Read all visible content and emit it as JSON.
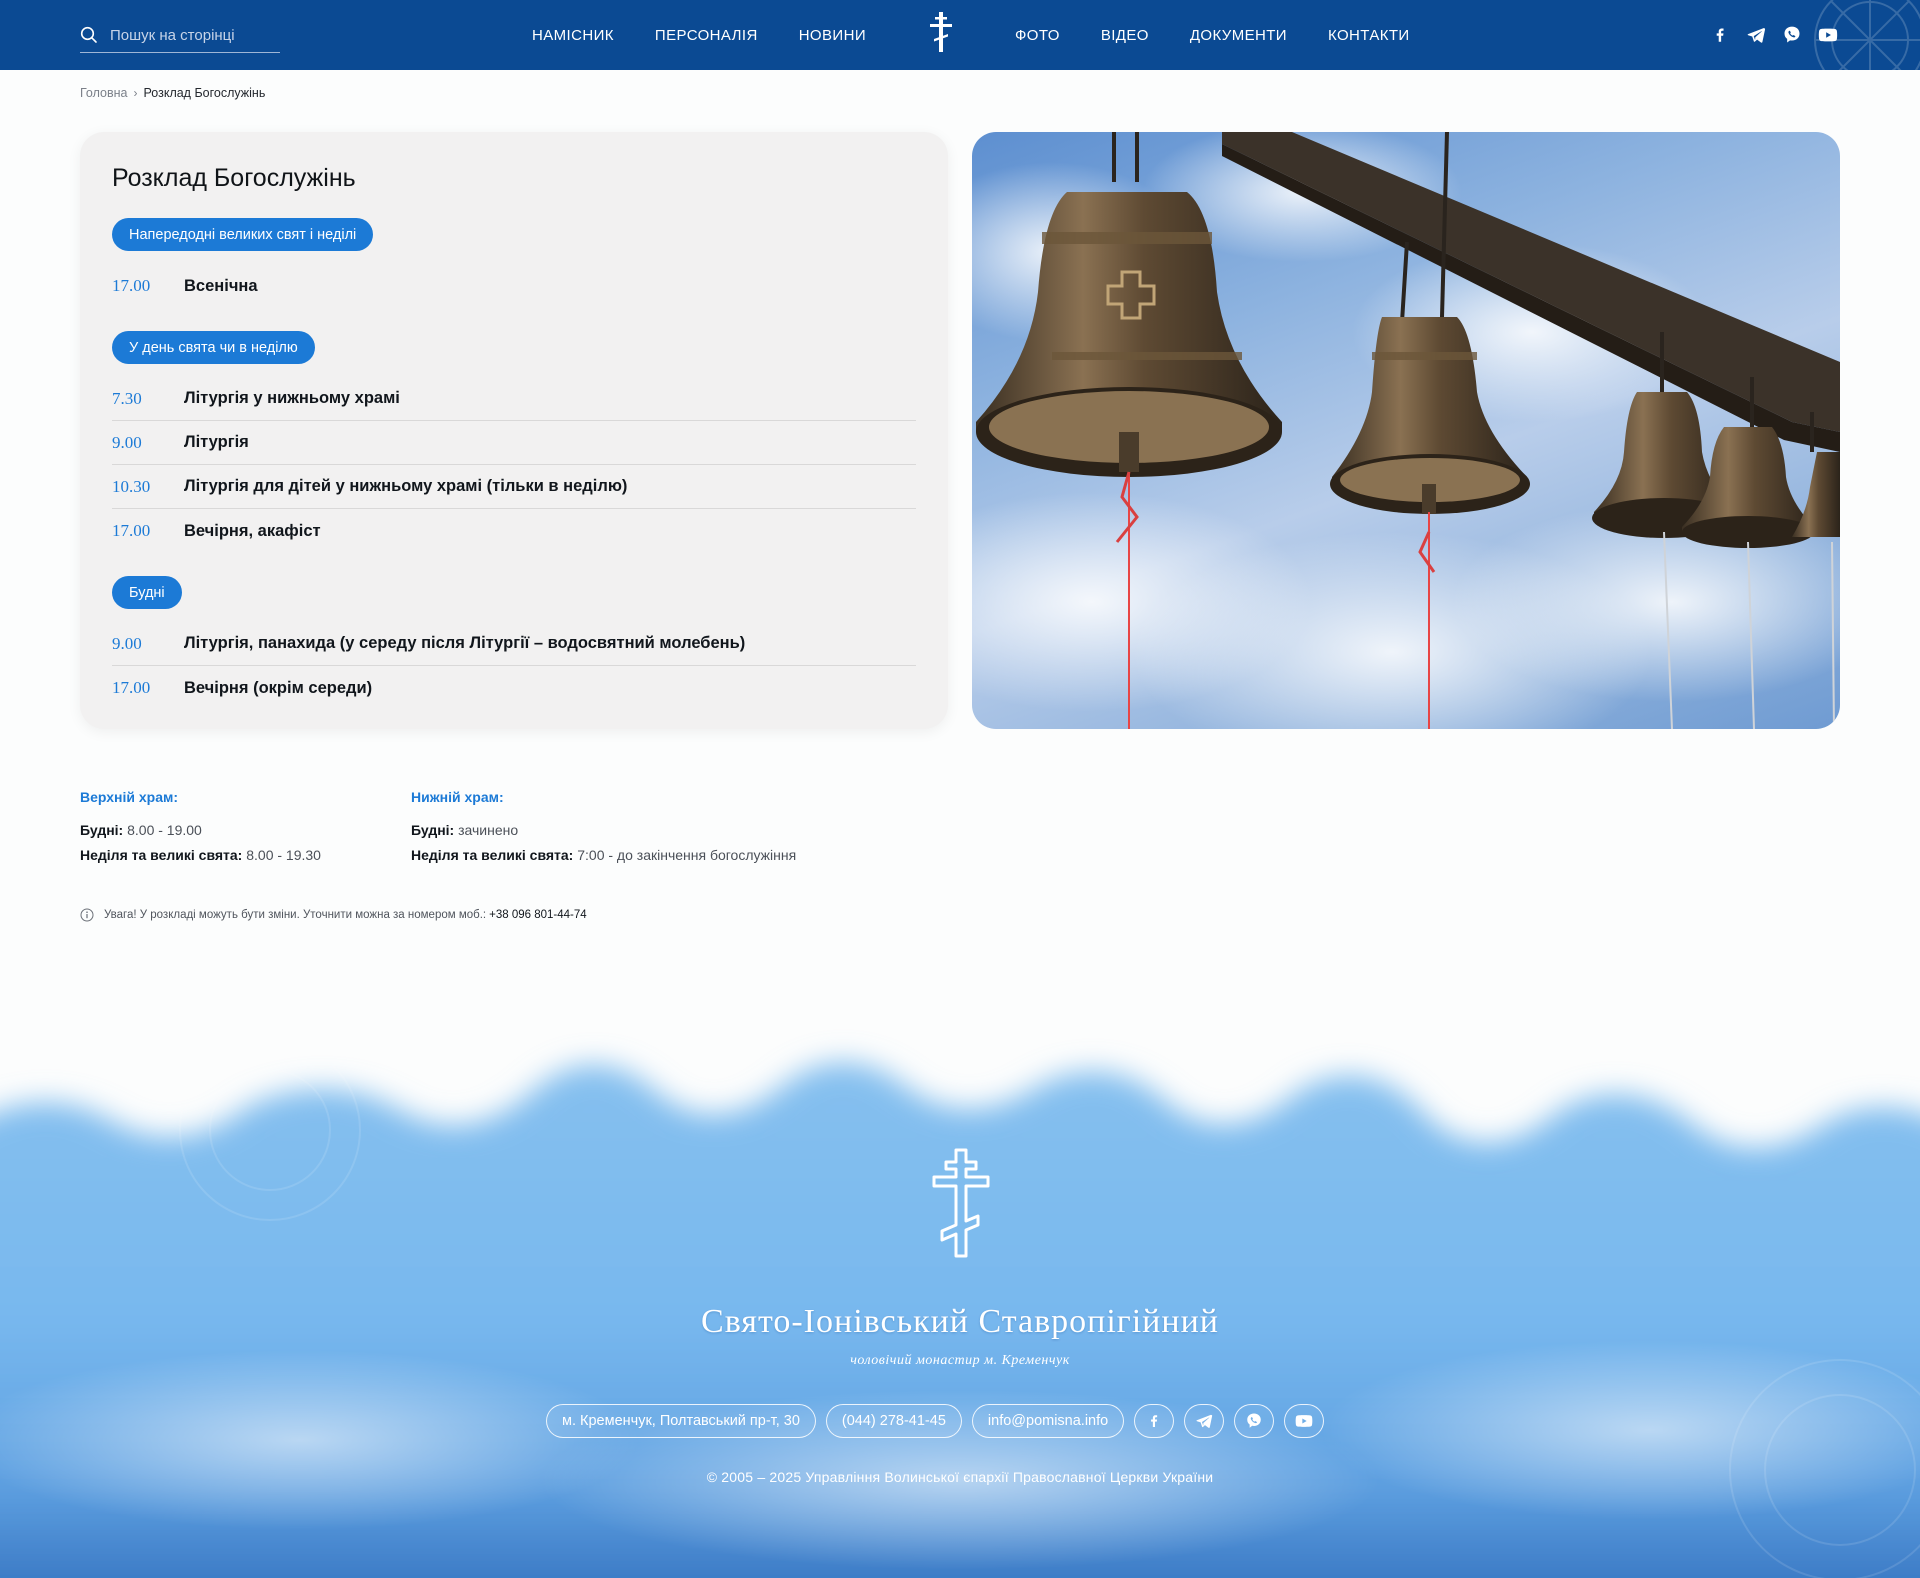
{
  "header": {
    "search_placeholder": "Пошук на сторінці",
    "nav_left": [
      "НАМІСНИК",
      "ПЕРСОНАЛІЯ",
      "НОВИНИ"
    ],
    "nav_right": [
      "ФОТО",
      "ВІДЕО",
      "ДОКУМЕНТИ",
      "КОНТАКТИ"
    ],
    "socials": [
      "facebook-icon",
      "telegram-icon",
      "viber-icon",
      "youtube-icon"
    ],
    "background_color": "#0b4a93"
  },
  "breadcrumb": {
    "home": "Головна",
    "separator": "›",
    "current": "Розклад Богослужінь"
  },
  "schedule": {
    "title": "Розклад Богослужінь",
    "accent_color": "#1c7ad6",
    "groups": [
      {
        "label": "Напередодні великих свят і неділі",
        "items": [
          {
            "time": "17.00",
            "name": "Всенічна"
          }
        ]
      },
      {
        "label": "У день свята чи в неділю",
        "items": [
          {
            "time": "7.30",
            "name": "Літургія у нижньому храмі"
          },
          {
            "time": "9.00",
            "name": "Літургія"
          },
          {
            "time": "10.30",
            "name": "Літургія для дітей у нижньому храмі (тільки в неділю)"
          },
          {
            "time": "17.00",
            "name": "Вечірня, акафіст"
          }
        ]
      },
      {
        "label": "Будні",
        "items": [
          {
            "time": "9.00",
            "name": "Літургія, панахида (у середу після Літургії – водосвятний молебень)"
          },
          {
            "time": "17.00",
            "name": "Вечірня (окрім середи)"
          }
        ]
      }
    ]
  },
  "hours": {
    "upper": {
      "title": "Верхній храм:",
      "weekdays_label": "Будні:",
      "weekdays_value": "8.00 - 19.00",
      "holidays_label": "Неділя та великі свята:",
      "holidays_value": "8.00 - 19.30"
    },
    "lower": {
      "title": "Нижній храм:",
      "weekdays_label": "Будні:",
      "weekdays_value": "зачинено",
      "holidays_label": "Неділя та великі свята:",
      "holidays_value": "7:00 - до закінчення богослужіння"
    }
  },
  "notice": {
    "text": "Увага! У розкладі можуть бути зміни. Уточнити можна за номером моб.:",
    "phone": "+38 096 801-44-74"
  },
  "footer": {
    "title": "Свято-Іонівський Ставропігійний",
    "subtitle": "чоловічий монастир м. Кременчук",
    "address": "м. Кременчук, Полтавський пр-т, 30",
    "phone": "(044) 278-41-45",
    "email": "info@pomisna.info",
    "copyright": "© 2005 – 2025 Управління Волинської єпархії Православної Церкви України"
  }
}
